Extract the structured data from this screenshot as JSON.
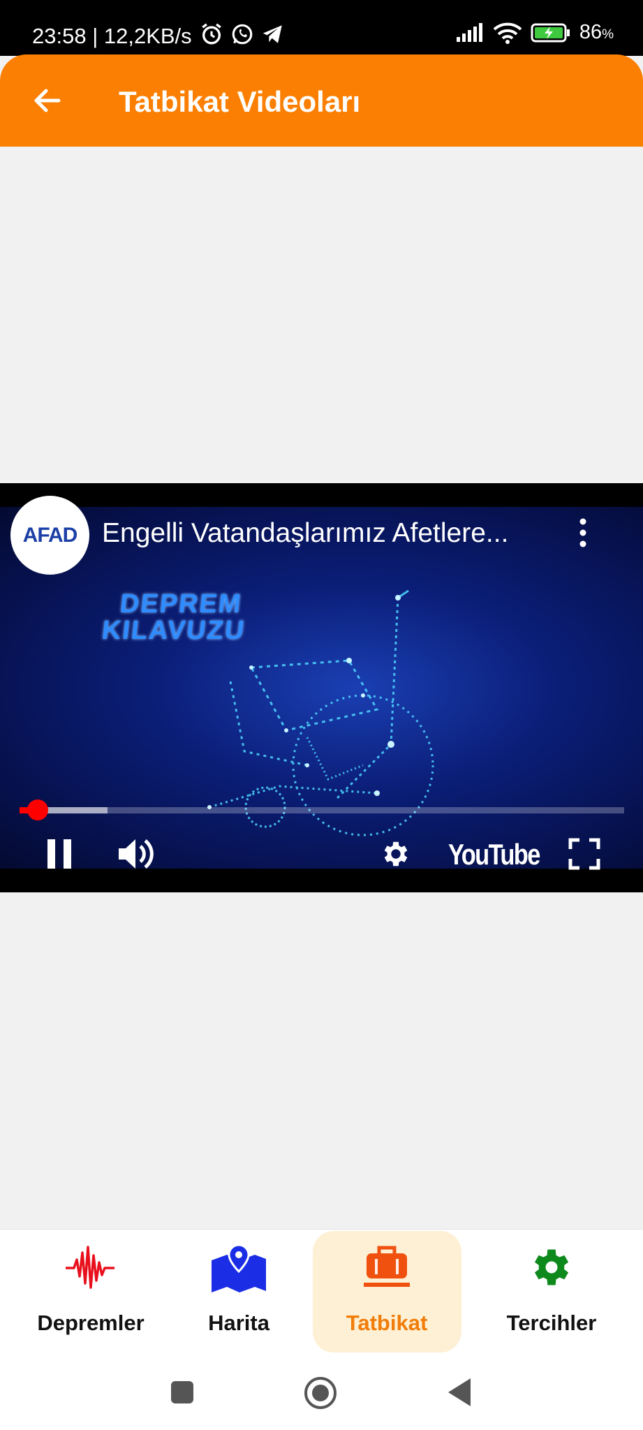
{
  "status_bar": {
    "time_speed": "23:58 | 12,2KB/s",
    "battery_percent": "86",
    "battery_unit": "%",
    "icons": [
      "alarm-icon",
      "whatsapp-icon",
      "telegram-icon",
      "signal-icon",
      "wifi-icon",
      "battery-charging-icon"
    ]
  },
  "app_bar": {
    "title": "Tatbikat Videoları",
    "back_icon": "arrow-left-icon",
    "color": "#fa7f03"
  },
  "video_player": {
    "channel_logo_text": "AFAD",
    "title": "Engelli Vatandaşlarımız Afetlere...",
    "overlay_line1": "DEPREM",
    "overlay_line2": "KILAVUZU",
    "played_fraction": 0.03,
    "buffered_fraction": 0.145,
    "brand_label": "YouTube",
    "controls": [
      "pause-icon",
      "volume-icon",
      "settings-icon",
      "fullscreen-icon",
      "more-vert-icon"
    ]
  },
  "bottom_nav": {
    "active_index": 2,
    "active_color": "#f17d0a",
    "items": [
      {
        "label": "Depremler",
        "icon": "seismograph-icon",
        "icon_color": "#e8101c"
      },
      {
        "label": "Harita",
        "icon": "map-pin-icon",
        "icon_color": "#1b2ee5"
      },
      {
        "label": "Tatbikat",
        "icon": "emergency-bag-icon",
        "icon_color": "#f0510e"
      },
      {
        "label": "Tercihler",
        "icon": "gear-icon",
        "icon_color": "#0e8a1d"
      }
    ]
  },
  "system_nav": [
    "recents-square-icon",
    "home-circle-icon",
    "back-triangle-icon"
  ]
}
